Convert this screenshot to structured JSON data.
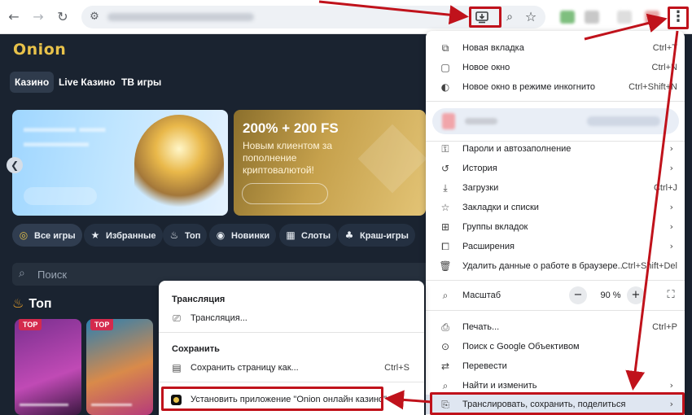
{
  "browser": {
    "back_icon": "arrow-left-icon",
    "forward_icon": "arrow-right-icon",
    "reload_icon": "reload-icon",
    "site_info_icon": "tune-icon",
    "install_icon": "install-app-icon",
    "zoom_icon": "magnifier-icon",
    "bookmark_icon": "star-icon",
    "menu_icon": "three-dots-vertical-icon"
  },
  "site": {
    "logo": "Onion",
    "categories": [
      "Казино",
      "Live Казино",
      "ТВ игры"
    ],
    "banner2": {
      "title": "200% + 200 FS",
      "subtitle": "Новым клиентом за пополнение криптовалютой!"
    },
    "filters": [
      "Все игры",
      "Избранные",
      "Топ",
      "Новинки",
      "Слоты",
      "Краш-игры"
    ],
    "search_placeholder": "Поиск",
    "section_title": "Топ",
    "game_badge": "TOP"
  },
  "menu": {
    "items_top": [
      {
        "label": "Новая вкладка",
        "shortcut": "Ctrl+T"
      },
      {
        "label": "Новое окно",
        "shortcut": "Ctrl+N"
      },
      {
        "label": "Новое окно в режиме инкогнито",
        "shortcut": "Ctrl+Shift+N"
      }
    ],
    "items_mid": [
      {
        "label": "Пароли и автозаполнение"
      },
      {
        "label": "История"
      },
      {
        "label": "Загрузки",
        "shortcut": "Ctrl+J"
      },
      {
        "label": "Закладки и списки"
      },
      {
        "label": "Группы вкладок"
      },
      {
        "label": "Расширения"
      },
      {
        "label": "Удалить данные о работе в браузере...",
        "shortcut": "Ctrl+Shift+Del"
      }
    ],
    "zoom": {
      "label": "Масштаб",
      "minus": "−",
      "value": "90 %",
      "plus": "+"
    },
    "items_bottom": [
      {
        "label": "Печать...",
        "shortcut": "Ctrl+P"
      },
      {
        "label": "Поиск с Google Объективом"
      },
      {
        "label": "Перевести"
      },
      {
        "label": "Найти и изменить"
      },
      {
        "label": "Транслировать, сохранить, поделиться"
      }
    ]
  },
  "submenu": {
    "cast_header": "Трансляция",
    "cast_item": "Трансляция...",
    "save_header": "Сохранить",
    "save_item": "Сохранить страницу как...",
    "save_shortcut": "Ctrl+S",
    "install_item": "Установить приложение \"Onion онлайн казино\""
  },
  "annotation_color": "#c0121b"
}
